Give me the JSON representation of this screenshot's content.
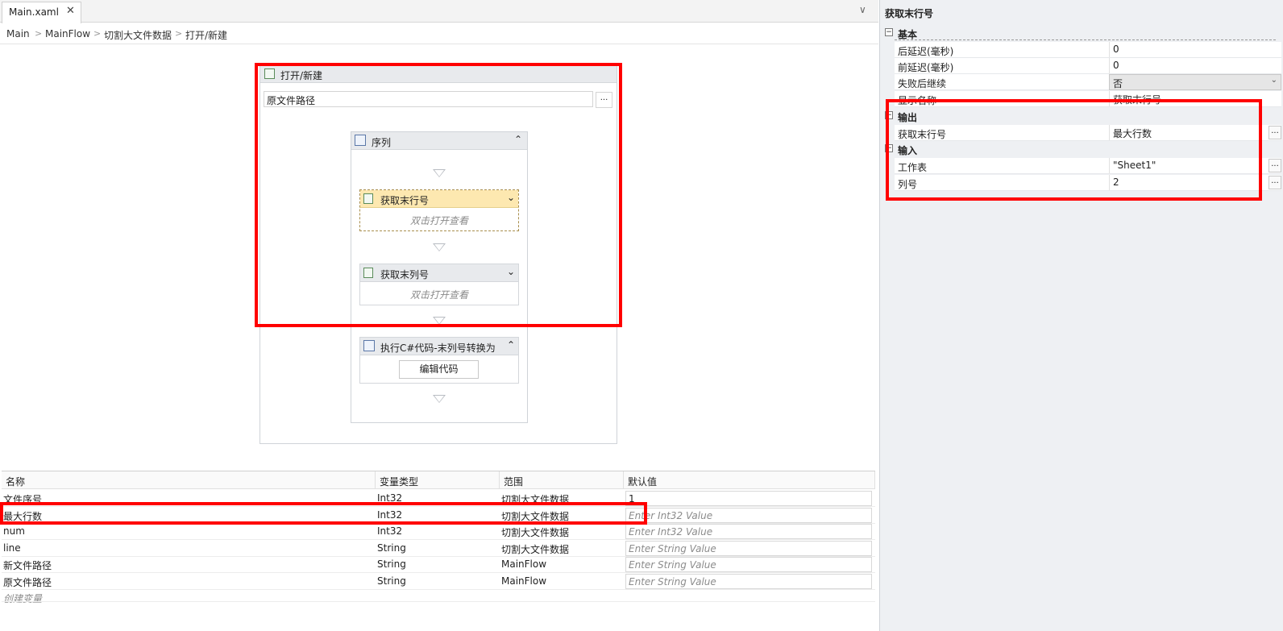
{
  "tab": {
    "label": "Main.xaml",
    "close": "✕"
  },
  "tabbar_chevron": "∨",
  "breadcrumb": [
    "Main",
    "MainFlow",
    "切割大文件数据",
    "打开/新建"
  ],
  "breadcrumb_sep": ">",
  "designer": {
    "open_new": {
      "title": "打开/新建",
      "path_value": "原文件路径",
      "browse_label": "..."
    },
    "sequence": {
      "title": "序列",
      "chevron": "⌃"
    },
    "get_last_row": {
      "title": "获取末行号",
      "hint": "双击打开查看",
      "chevron": "⌄"
    },
    "get_last_col": {
      "title": "获取末列号",
      "hint": "双击打开查看",
      "chevron": "⌄"
    },
    "exec_code": {
      "title": "执行C#代码-末列号转换为",
      "button": "编辑代码",
      "chevron": "⌃"
    }
  },
  "variables": {
    "headers": [
      "名称",
      "变量类型",
      "范围",
      "默认值"
    ],
    "rows": [
      {
        "name": "文件序号",
        "type": "Int32",
        "scope": "切割大文件数据",
        "default": "1",
        "placeholder": false
      },
      {
        "name": "最大行数",
        "type": "Int32",
        "scope": "切割大文件数据",
        "default": "Enter Int32 Value",
        "placeholder": true
      },
      {
        "name": "num",
        "type": "Int32",
        "scope": "切割大文件数据",
        "default": "Enter Int32 Value",
        "placeholder": true
      },
      {
        "name": "line",
        "type": "String",
        "scope": "切割大文件数据",
        "default": "Enter String Value",
        "placeholder": true
      },
      {
        "name": "新文件路径",
        "type": "String",
        "scope": "MainFlow",
        "default": "Enter String Value",
        "placeholder": true
      },
      {
        "name": "原文件路径",
        "type": "String",
        "scope": "MainFlow",
        "default": "Enter String Value",
        "placeholder": true
      }
    ],
    "create_label": "创建变量"
  },
  "properties": {
    "title": "获取末行号",
    "basic": {
      "label": "基本",
      "toggle": "⊟",
      "after_delay": {
        "label": "后延迟(毫秒)",
        "value": "0"
      },
      "before_delay": {
        "label": "前延迟(毫秒)",
        "value": "0"
      },
      "continue_on_error": {
        "label": "失败后继续",
        "value": "否",
        "arrow": "⌄"
      },
      "display_name": {
        "label": "显示名称",
        "value": "获取末行号"
      }
    },
    "output": {
      "label": "输出",
      "toggle": "⊟",
      "get_last_row": {
        "label": "获取末行号",
        "value": "最大行数",
        "btn": "..."
      }
    },
    "input": {
      "label": "输入",
      "toggle": "⊟",
      "worksheet": {
        "label": "工作表",
        "value": "\"Sheet1\"",
        "btn": "..."
      },
      "column": {
        "label": "列号",
        "value": "2",
        "btn": "..."
      }
    }
  },
  "colors": {
    "highlight": "#ff0000",
    "selected_activity": "#fde8b0",
    "panel_bg": "#eef0f3"
  }
}
